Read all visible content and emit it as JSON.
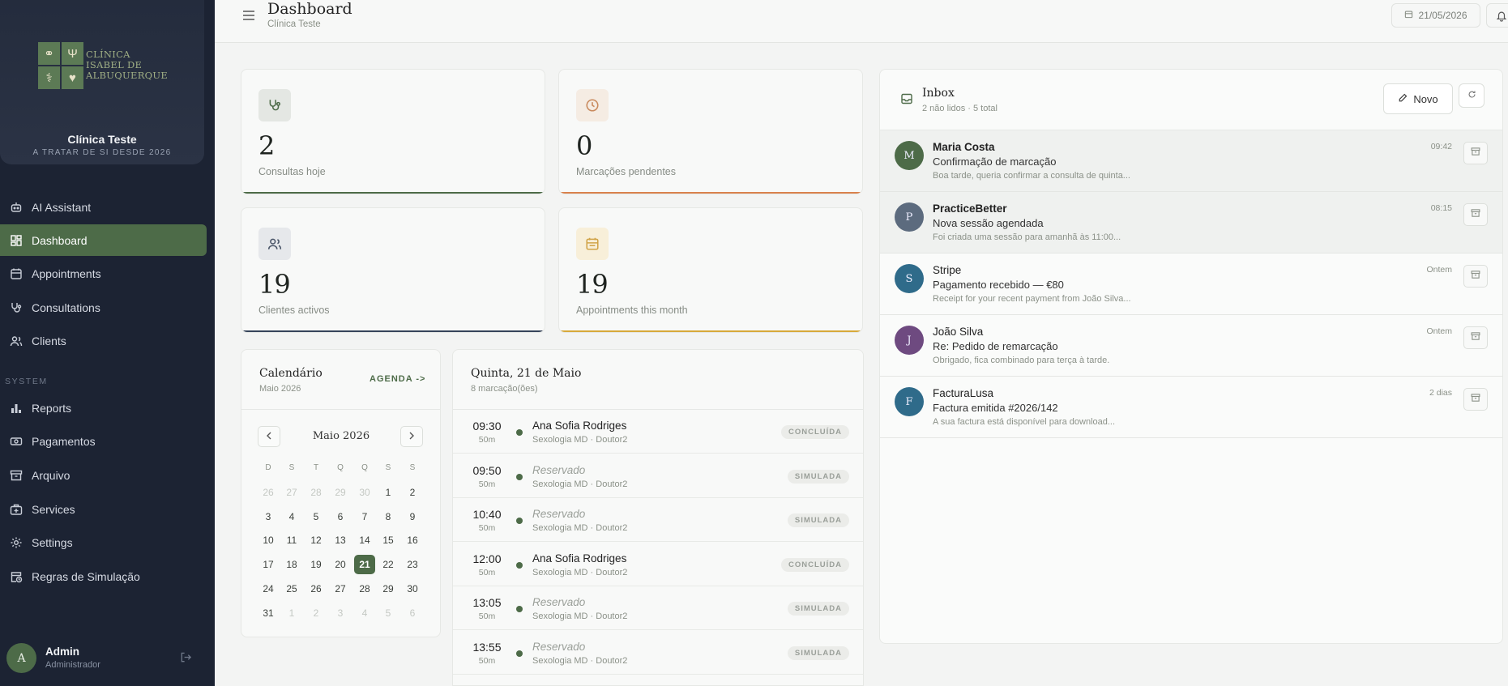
{
  "brand": {
    "logo_text_lines": [
      "CLÍNICA",
      "ISABEL DE",
      "ALBUQUERQUE"
    ],
    "clinic_name": "Clínica Teste",
    "tagline": "A TRATAR DE SI DESDE 2026"
  },
  "sidebar": {
    "items": [
      {
        "label": "AI Assistant",
        "icon": "robot-icon"
      },
      {
        "label": "Dashboard",
        "icon": "dashboard-grid-icon",
        "active": true
      },
      {
        "label": "Appointments",
        "icon": "calendar-icon"
      },
      {
        "label": "Consultations",
        "icon": "stethoscope-icon"
      },
      {
        "label": "Clients",
        "icon": "users-icon"
      }
    ],
    "section_label": "SYSTEM",
    "system_items": [
      {
        "label": "Reports",
        "icon": "bar-chart-icon"
      },
      {
        "label": "Pagamentos",
        "icon": "banknote-icon"
      },
      {
        "label": "Arquivo",
        "icon": "archive-icon"
      },
      {
        "label": "Services",
        "icon": "medical-bag-icon"
      },
      {
        "label": "Settings",
        "icon": "gear-icon"
      },
      {
        "label": "Regras de Simulação",
        "icon": "calendar-clock-icon"
      }
    ],
    "user": {
      "initial": "A",
      "name": "Admin",
      "role": "Administrador"
    }
  },
  "header": {
    "title": "Dashboard",
    "subtitle": "Clínica Teste",
    "date": "21/05/2026"
  },
  "stats": [
    {
      "value": "2",
      "label": "Consultas hoje",
      "icon": "stethoscope-icon",
      "color": "#4d6b48"
    },
    {
      "value": "0",
      "label": "Marcações pendentes",
      "icon": "clock-icon",
      "color": "#d9824c"
    },
    {
      "value": "19",
      "label": "Clientes activos",
      "icon": "users-icon",
      "color": "#36445a"
    },
    {
      "value": "19",
      "label": "Appointments this month",
      "icon": "calendar-icon",
      "color": "#d7a93a"
    }
  ],
  "calendar": {
    "title": "Calendário",
    "subtitle": "Maio 2026",
    "agenda_link": "AGENDA ->",
    "month_label": "Maio 2026",
    "weekdays": [
      "D",
      "S",
      "T",
      "Q",
      "Q",
      "S",
      "S"
    ],
    "weeks": [
      [
        "26",
        "27",
        "28",
        "29",
        "30",
        "1",
        "2"
      ],
      [
        "3",
        "4",
        "5",
        "6",
        "7",
        "8",
        "9"
      ],
      [
        "10",
        "11",
        "12",
        "13",
        "14",
        "15",
        "16"
      ],
      [
        "17",
        "18",
        "19",
        "20",
        "21",
        "22",
        "23"
      ],
      [
        "24",
        "25",
        "26",
        "27",
        "28",
        "29",
        "30"
      ],
      [
        "31",
        "1",
        "2",
        "3",
        "4",
        "5",
        "6"
      ]
    ],
    "selected": "21"
  },
  "agenda": {
    "title": "Quinta, 21 de Maio",
    "subtitle": "8 marcação(ões)",
    "rows": [
      {
        "time": "09:30",
        "duration": "50m",
        "patient": "Ana Sofia Rodriges",
        "service": "Sexologia MD · Doutor2",
        "status": "CONCLUÍDA",
        "reserved": false
      },
      {
        "time": "09:50",
        "duration": "50m",
        "patient": "Reservado",
        "service": "Sexologia MD · Doutor2",
        "status": "SIMULADA",
        "reserved": true
      },
      {
        "time": "10:40",
        "duration": "50m",
        "patient": "Reservado",
        "service": "Sexologia MD · Doutor2",
        "status": "SIMULADA",
        "reserved": true
      },
      {
        "time": "12:00",
        "duration": "50m",
        "patient": "Ana Sofia Rodriges",
        "service": "Sexologia MD · Doutor2",
        "status": "CONCLUÍDA",
        "reserved": false
      },
      {
        "time": "13:05",
        "duration": "50m",
        "patient": "Reservado",
        "service": "Sexologia MD · Doutor2",
        "status": "SIMULADA",
        "reserved": true
      },
      {
        "time": "13:55",
        "duration": "50m",
        "patient": "Reservado",
        "service": "Sexologia MD · Doutor2",
        "status": "SIMULADA",
        "reserved": true
      }
    ]
  },
  "inbox": {
    "title": "Inbox",
    "subtitle": "2 não lidos · 5 total",
    "new_label": "Novo",
    "messages": [
      {
        "initial": "M",
        "from": "Maria Costa",
        "subject": "Confirmação de marcação",
        "preview": "Boa tarde, queria confirmar a consulta de quinta...",
        "time": "09:42",
        "unread": true,
        "color": "#4d6b48"
      },
      {
        "initial": "P",
        "from": "PracticeBetter",
        "subject": "Nova sessão agendada",
        "preview": "Foi criada uma sessão para amanhã às 11:00...",
        "time": "08:15",
        "unread": true,
        "color": "#5c6b7e"
      },
      {
        "initial": "S",
        "from": "Stripe",
        "subject": "Pagamento recebido — €80",
        "preview": "Receipt for your recent payment from João Silva...",
        "time": "Ontem",
        "unread": false,
        "color": "#2f6b8a"
      },
      {
        "initial": "J",
        "from": "João Silva",
        "subject": "Re: Pedido de remarcação",
        "preview": "Obrigado, fica combinado para terça à tarde.",
        "time": "Ontem",
        "unread": false,
        "color": "#6e4a80"
      },
      {
        "initial": "F",
        "from": "FacturaLusa",
        "subject": "Factura emitida #2026/142",
        "preview": "A sua factura está disponível para download...",
        "time": "2 dias",
        "unread": false,
        "color": "#2f6b8a"
      }
    ]
  }
}
